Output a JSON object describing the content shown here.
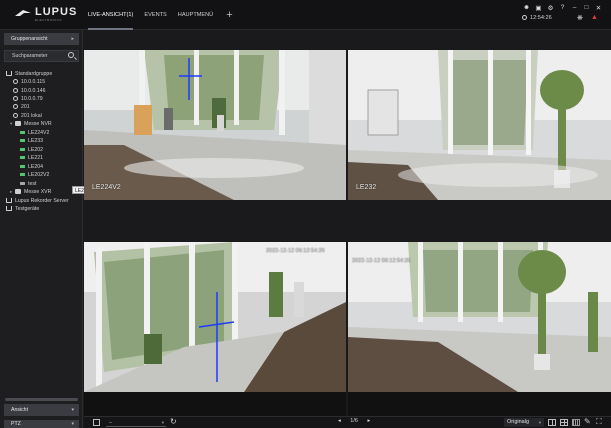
{
  "app": {
    "logo_text": "LUPUS",
    "logo_subtext": "ELECTRONICS"
  },
  "nav": {
    "tabs": [
      {
        "label": "LIVE-ANSICHT(1)",
        "active": true
      },
      {
        "label": "EVENTS",
        "active": false
      },
      {
        "label": "HAUPTMENÜ",
        "active": false
      }
    ],
    "add_label": "+"
  },
  "tray": {
    "user_icon": "user-icon",
    "lock_icon": "lock-icon",
    "settings_icon": "gear-icon",
    "help_label": "?",
    "minimize_label": "–",
    "maximize_label": "□",
    "close_label": "✕",
    "time": "12:54:26",
    "alert_icon": "alert-icon"
  },
  "sidebar": {
    "group_view_label": "Gruppenansicht",
    "search_label": "Suchparameter",
    "tree": [
      {
        "label": "Standardgruppe",
        "icon": "network-icon",
        "level": 0
      },
      {
        "label": "10.0.0.115",
        "icon": "pin-icon",
        "level": 1
      },
      {
        "label": "10.0.0.146",
        "icon": "pin-icon",
        "level": 1
      },
      {
        "label": "10.0.0.79",
        "icon": "pin-icon",
        "level": 1
      },
      {
        "label": "201",
        "icon": "pin-icon",
        "level": 1
      },
      {
        "label": "201 lokal",
        "icon": "pin-icon",
        "level": 1
      },
      {
        "label": "Messe NVR",
        "icon": "folder-icon",
        "level": 0,
        "expanded": true
      },
      {
        "label": "LE224V2",
        "icon": "camera-icon",
        "level": 2
      },
      {
        "label": "LE233",
        "icon": "camera-icon",
        "level": 2
      },
      {
        "label": "LE202",
        "icon": "camera-icon",
        "level": 2
      },
      {
        "label": "LE221",
        "icon": "camera-icon",
        "level": 2
      },
      {
        "label": "LE204",
        "icon": "camera-icon",
        "level": 2
      },
      {
        "label": "LE202V2",
        "icon": "camera-icon",
        "level": 2
      },
      {
        "label": "test",
        "icon": "camera-grey-icon",
        "level": 2
      },
      {
        "label": "Messe XVR",
        "icon": "folder-icon",
        "level": 0,
        "expanded": false
      },
      {
        "label": "Lupus Rekorder Server",
        "icon": "network-icon",
        "level": 0
      },
      {
        "label": "Testgeräte",
        "icon": "network-icon",
        "level": 0
      }
    ],
    "tooltip": "LE204",
    "view_label": "Ansicht",
    "ptz_label": "PTZ"
  },
  "tiles": [
    {
      "label": "LE224V2",
      "timestamp": ""
    },
    {
      "label": "LE232",
      "timestamp": ""
    },
    {
      "label": "",
      "timestamp": "2022-12-12 06:12:54:26"
    },
    {
      "label": "",
      "timestamp": "2022-12-12 06:12:54:26"
    }
  ],
  "bottombar": {
    "select_value": "–",
    "page": "1/6",
    "prev_label": "◂",
    "next_label": "▸",
    "aspect_label": "Originalg"
  }
}
